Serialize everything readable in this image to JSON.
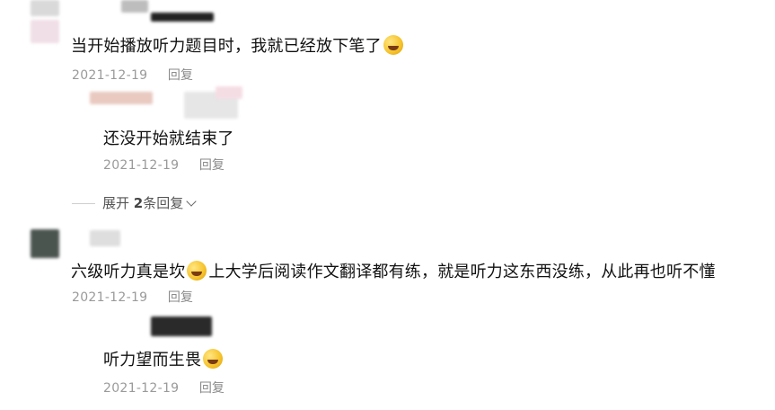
{
  "comments": [
    {
      "text_before": "当开始播放听力题目时，我就已经放下笔了",
      "text_after": "",
      "emoji": "laughing-tears-icon",
      "date": "2021-12-19",
      "reply_label": "回复",
      "replies": [
        {
          "text_before": "还没开始就结束了",
          "text_after": "",
          "date": "2021-12-19",
          "reply_label": "回复"
        }
      ],
      "expand": {
        "prefix": "展开",
        "count": "2",
        "suffix": "条回复"
      }
    },
    {
      "text_before": "六级听力真是坎",
      "emoji": "flushed-face-icon",
      "text_after": "上大学后阅读作文翻译都有练，就是听力这东西没练，从此再也听不懂",
      "date": "2021-12-19",
      "reply_label": "回复",
      "replies": [
        {
          "text_before": "听力望而生畏",
          "emoji": "grinning-sweat-icon",
          "text_after": "",
          "date": "2021-12-19",
          "reply_label": "回复"
        }
      ]
    }
  ]
}
